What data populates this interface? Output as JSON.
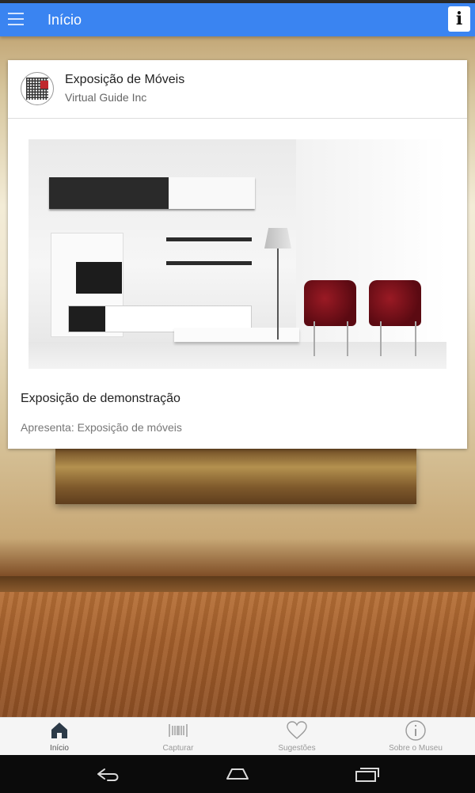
{
  "app_bar": {
    "title": "Início",
    "menu_icon": "menu-icon",
    "info_icon_glyph": "i"
  },
  "card": {
    "header_title": "Exposição de Móveis",
    "header_subtitle": "Virtual Guide Inc",
    "body_title": "Exposição de demonstração",
    "body_text": "Apresenta: Exposição de móveis"
  },
  "bottom_nav": {
    "items": [
      {
        "label": "Início",
        "icon": "home-icon",
        "active": true
      },
      {
        "label": "Capturar",
        "icon": "barcode-icon",
        "active": false
      },
      {
        "label": "Sugestões",
        "icon": "heart-icon",
        "active": false
      },
      {
        "label": "Sobre o Museu",
        "icon": "info-circle-icon",
        "active": false
      }
    ]
  },
  "system_nav": {
    "buttons": [
      "back-icon",
      "home-icon",
      "recents-icon"
    ]
  },
  "colors": {
    "app_bar": "#3a84f1",
    "card_bg": "#ffffff",
    "bottom_nav_bg": "#f5f5f5",
    "system_bar": "#0b0b0b"
  }
}
